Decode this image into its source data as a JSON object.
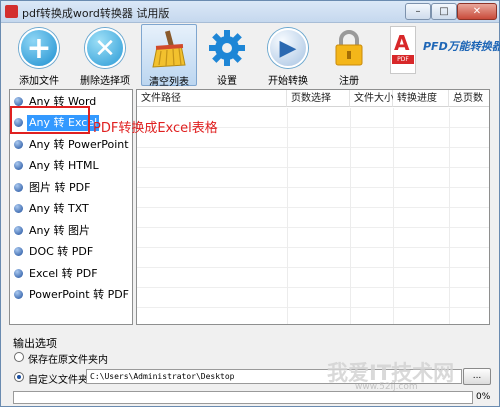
{
  "window": {
    "title": "pdf转换成word转换器 试用版",
    "min_glyph": "–",
    "max_glyph": "□",
    "close_glyph": "✕"
  },
  "toolbar": {
    "items": [
      {
        "label": "添加文件",
        "icon": "add-icon",
        "glyph": "+"
      },
      {
        "label": "删除选择项",
        "icon": "delete-icon",
        "glyph": "✕"
      },
      {
        "label": "清空列表",
        "icon": "broom-icon"
      },
      {
        "label": "设置",
        "icon": "gear-icon"
      },
      {
        "label": "开始转换",
        "icon": "play-icon",
        "glyph": "▶"
      },
      {
        "label": "注册",
        "icon": "lock-icon"
      }
    ],
    "brand": {
      "text": "PFD万能转换器",
      "doc_mark": "A",
      "doc_tag": "PDF"
    }
  },
  "conversion_modes": {
    "items": [
      "Any 转 Word",
      "Any 转 Excel",
      "Any 转 PowerPoint",
      "Any 转 HTML",
      "图片 转 PDF",
      "Any 转 TXT",
      "Any 转 图片",
      "DOC 转 PDF",
      "Excel 转 PDF",
      "PowerPoint 转 PDF"
    ],
    "selected_index": 1
  },
  "annotation": "PDF转换成Excel表格",
  "file_table": {
    "columns": [
      "文件路径",
      "页数选择",
      "文件大小",
      "转换进度",
      "总页数"
    ],
    "rows": []
  },
  "output": {
    "title": "输出选项",
    "option_source": "保存在原文件夹内",
    "option_custom": "自定义文件夹",
    "selected": "custom",
    "path": "C:\\Users\\Administrator\\Desktop",
    "browse_label": "..."
  },
  "progress": {
    "value": 0,
    "text": "0%",
    "fill_color": "#3aa84a"
  },
  "watermark": {
    "main": "我爱IT技术网",
    "sub": "www.52ij.com"
  },
  "colors": {
    "selection": "#3399ff",
    "annotation": "#e02020",
    "brand": "#1e66b6"
  }
}
